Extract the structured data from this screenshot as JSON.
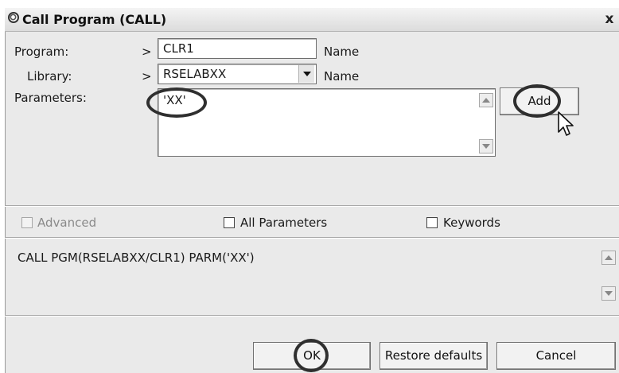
{
  "window": {
    "title": "Call Program (CALL)",
    "close_label": "x"
  },
  "form": {
    "program": {
      "label": "Program:",
      "prompt": ">",
      "value": "CLR1",
      "hint": "Name"
    },
    "library": {
      "label": "Library:",
      "prompt": ">",
      "value": "RSELABXX",
      "hint": "Name"
    },
    "parameters": {
      "label": "Parameters:",
      "value": "'XX'",
      "add_label": "Add"
    }
  },
  "options": {
    "advanced": {
      "label": "Advanced",
      "checked": false,
      "disabled": true
    },
    "all_parameters": {
      "label": "All Parameters",
      "checked": false
    },
    "keywords": {
      "label": "Keywords",
      "checked": false
    }
  },
  "command_preview": "CALL PGM(RSELABXX/CLR1) PARM('XX')",
  "buttons": {
    "ok": "OK",
    "restore": "Restore defaults",
    "cancel": "Cancel"
  },
  "icons": {
    "title": "call-program-icon",
    "close": "close-icon",
    "cursor": "mouse-pointer-icon"
  },
  "colors": {
    "dialog_bg": "#eaeaea",
    "field_bg": "#ffffff",
    "annotation": "#2f2f2f"
  }
}
